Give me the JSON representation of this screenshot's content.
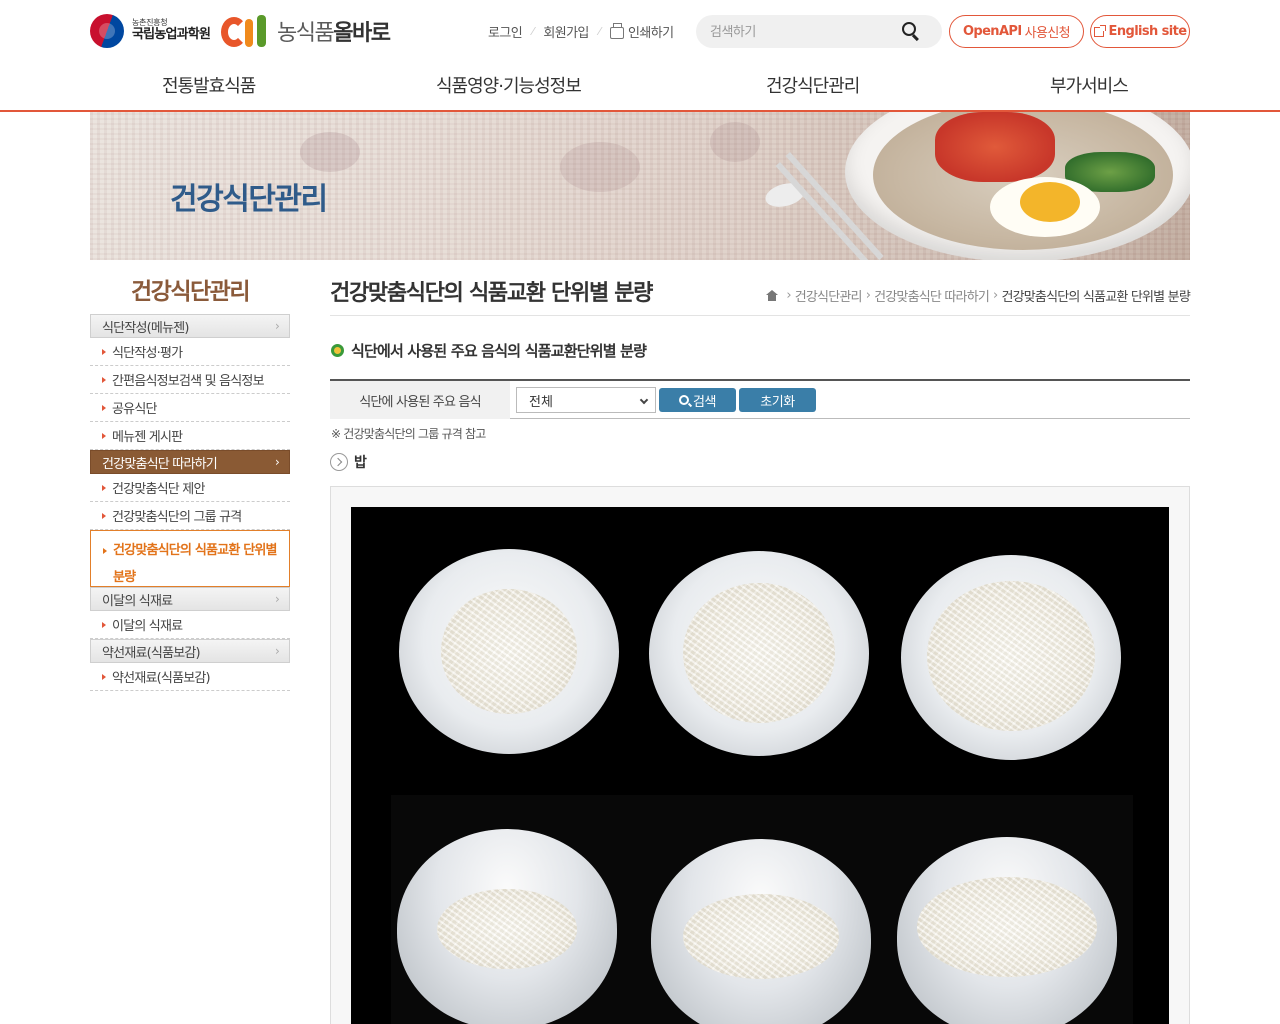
{
  "header": {
    "rda": {
      "small": "농촌진흥청",
      "big": "국립농업과학원"
    },
    "brand": {
      "prefix": "농식품",
      "bold": "올바로"
    },
    "util": {
      "login": "로그인",
      "join": "회원가입",
      "print": "인쇄하기"
    },
    "search": {
      "placeholder": "검색하기"
    },
    "openapi": {
      "bold": "OpenAPI",
      "rest": "사용신청"
    },
    "english": "English site",
    "gnb": [
      "전통발효식품",
      "식품영양·기능성정보",
      "건강식단관리",
      "부가서비스"
    ]
  },
  "banner": {
    "title": "건강식단관리"
  },
  "lnb": {
    "title": "건강식단관리",
    "groups": [
      {
        "label": "식단작성(메뉴젠)",
        "items": [
          "식단작성·평가",
          "간편음식정보검색 및 음식정보",
          "공유식단",
          "메뉴젠 게시판"
        ]
      },
      {
        "label": "건강맞춤식단 따라하기",
        "items": [
          "건강맞춤식단 제안",
          "건강맞춤식단의 그룹 규격",
          "건강맞춤식단의 식품교환 단위별 분량"
        ]
      },
      {
        "label": "이달의 식재료",
        "items": [
          "이달의 식재료"
        ]
      },
      {
        "label": "약선재료(식품보감)",
        "items": [
          "약선재료(식품보감)"
        ]
      }
    ]
  },
  "content": {
    "title": "건강맞춤식단의 식품교환 단위별 분량",
    "breadcrumb": [
      "건강식단관리",
      "건강맞춤식단 따라하기",
      "건강맞춤식단의 식품교환 단위별 분량"
    ],
    "section_title": "식단에서 사용된 주요 음식의 식품교환단위별 분량",
    "filter": {
      "label": "식단에 사용된 주요 음식",
      "selected": "전체",
      "search_btn": "검색",
      "reset_btn": "초기화"
    },
    "note": "※ 건강맞춤식단의 그룹 규격 참고",
    "category": "밥"
  },
  "colors": {
    "accent": "#e2573a",
    "brown": "#8a5a34",
    "button_blue": "#3a7ea8",
    "banner_title": "#2f5b8a"
  }
}
